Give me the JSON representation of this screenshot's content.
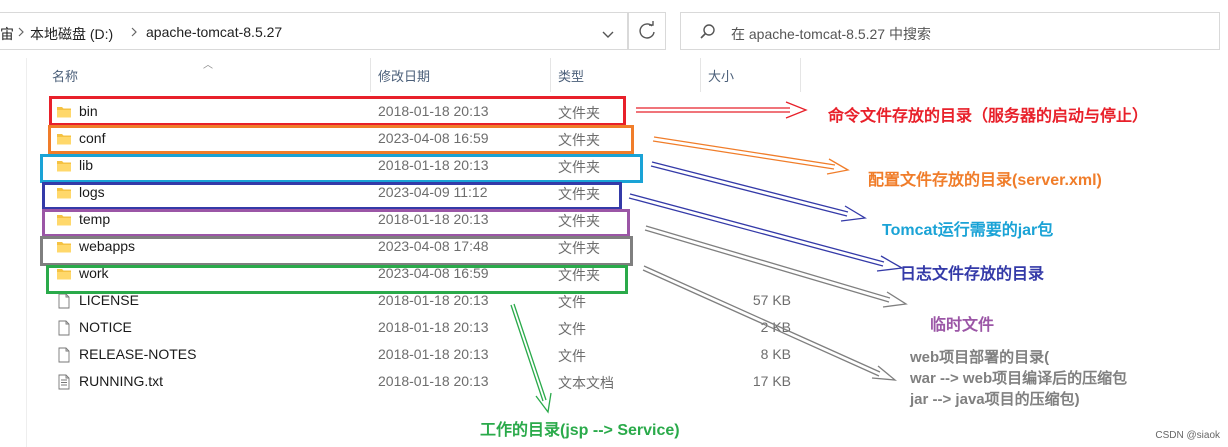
{
  "address": {
    "partial_left": "宙",
    "crumbs": [
      "本地磁盘 (D:)",
      "apache-tomcat-8.5.27"
    ]
  },
  "search": {
    "placeholder": "在 apache-tomcat-8.5.27 中搜索"
  },
  "columns": {
    "name": "名称",
    "modified": "修改日期",
    "type": "类型",
    "size": "大小"
  },
  "files": [
    {
      "name": "bin",
      "date": "2018-01-18 20:13",
      "type": "文件夹",
      "size": "",
      "kind": "folder"
    },
    {
      "name": "conf",
      "date": "2023-04-08 16:59",
      "type": "文件夹",
      "size": "",
      "kind": "folder"
    },
    {
      "name": "lib",
      "date": "2018-01-18 20:13",
      "type": "文件夹",
      "size": "",
      "kind": "folder"
    },
    {
      "name": "logs",
      "date": "2023-04-09 11:12",
      "type": "文件夹",
      "size": "",
      "kind": "folder"
    },
    {
      "name": "temp",
      "date": "2018-01-18 20:13",
      "type": "文件夹",
      "size": "",
      "kind": "folder"
    },
    {
      "name": "webapps",
      "date": "2023-04-08 17:48",
      "type": "文件夹",
      "size": "",
      "kind": "folder"
    },
    {
      "name": "work",
      "date": "2023-04-08 16:59",
      "type": "文件夹",
      "size": "",
      "kind": "folder"
    },
    {
      "name": "LICENSE",
      "date": "2018-01-18 20:13",
      "type": "文件",
      "size": "57 KB",
      "kind": "file"
    },
    {
      "name": "NOTICE",
      "date": "2018-01-18 20:13",
      "type": "文件",
      "size": "2 KB",
      "kind": "file"
    },
    {
      "name": "RELEASE-NOTES",
      "date": "2018-01-18 20:13",
      "type": "文件",
      "size": "8 KB",
      "kind": "file"
    },
    {
      "name": "RUNNING.txt",
      "date": "2018-01-18 20:13",
      "type": "文本文档",
      "size": "17 KB",
      "kind": "text"
    }
  ],
  "annotations": {
    "bin": "命令文件存放的目录（服务器的启动与停止）",
    "conf": "配置文件存放的目录(server.xml)",
    "lib": "Tomcat运行需要的jar包",
    "logs": "日志文件存放的目录",
    "temp": "临时文件",
    "webapps_1": "web项目部署的目录(",
    "webapps_2": "war --> web项目编译后的压缩包",
    "webapps_3": "jar --> java项目的压缩包)",
    "work": "工作的目录(jsp --> Service)"
  },
  "colors": {
    "bin": "#e8202a",
    "conf": "#f07d2a",
    "lib": "#1aa3d6",
    "logs": "#343aa8",
    "temp": "#9b56a6",
    "webapps": "#7f7f7f",
    "work": "#2aaa4a",
    "folder": "#f5c242"
  },
  "watermark": "CSDN @siaok"
}
